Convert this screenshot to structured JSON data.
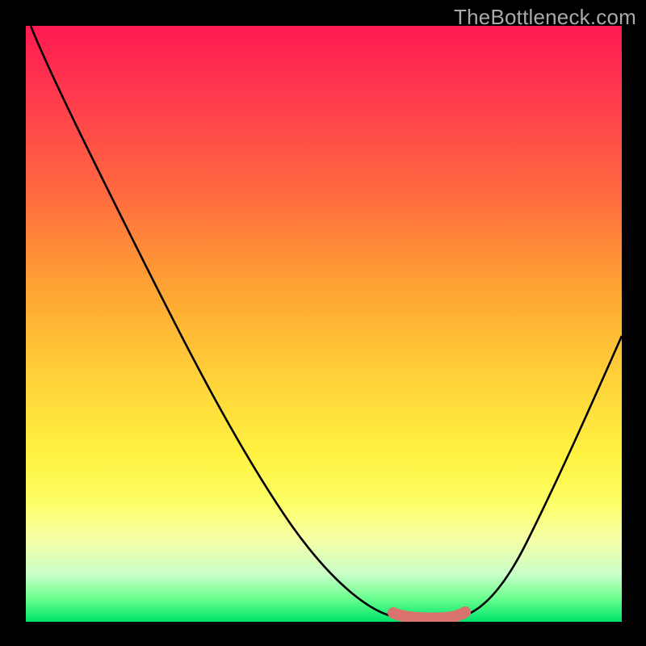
{
  "watermark": "TheBottleneck.com",
  "chart_data": {
    "type": "line",
    "title": "",
    "xlabel": "",
    "ylabel": "",
    "xlim": [
      0,
      100
    ],
    "ylim": [
      0,
      100
    ],
    "grid": false,
    "series": [
      {
        "name": "bottleneck-curve",
        "x": [
          0,
          5,
          10,
          15,
          20,
          25,
          30,
          35,
          40,
          45,
          50,
          55,
          60,
          62,
          65,
          68,
          70,
          72,
          75,
          80,
          85,
          90,
          95,
          100
        ],
        "values": [
          4,
          12,
          20,
          28,
          36,
          44,
          52,
          60,
          68,
          76,
          84,
          92,
          98,
          100,
          100,
          100,
          98,
          96,
          92,
          84,
          76,
          68,
          60,
          52
        ]
      },
      {
        "name": "highlight-band",
        "x": [
          62,
          65,
          68,
          70,
          72
        ],
        "values": [
          100,
          100,
          100,
          100,
          100
        ]
      }
    ],
    "annotations": []
  },
  "colors": {
    "curve": "#000000",
    "highlight": "#d8736e",
    "background_top": "#ff1a52",
    "background_bottom": "#00e36b",
    "frame": "#000000",
    "watermark": "#a9a9a9"
  }
}
